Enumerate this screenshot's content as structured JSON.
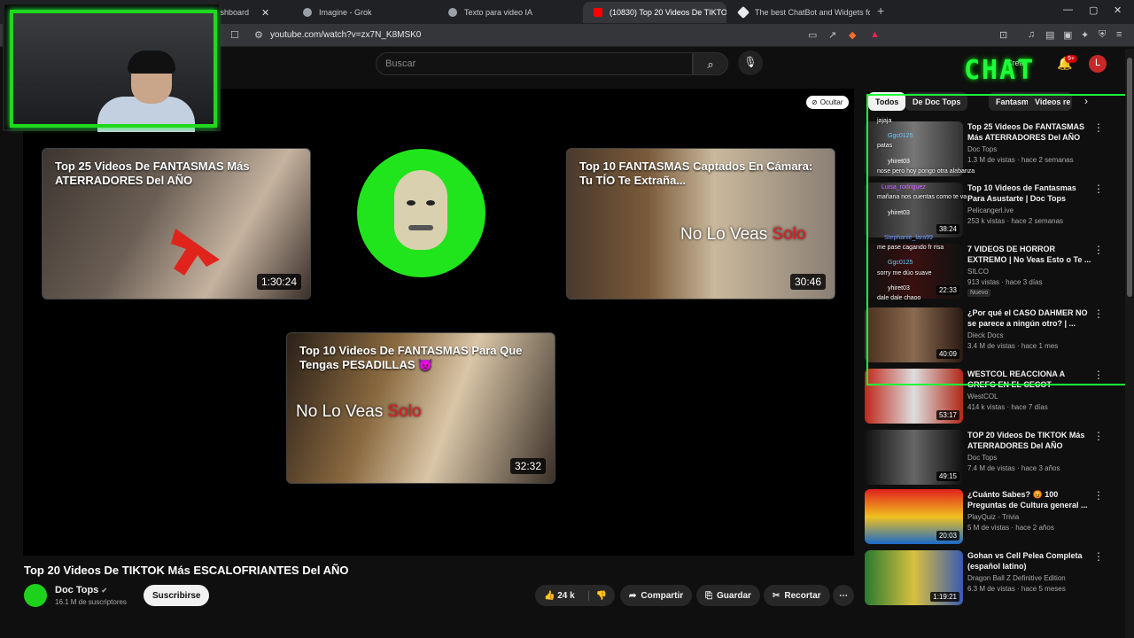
{
  "browser": {
    "tabs": [
      {
        "label": "Dashboard",
        "color": "#5f6368"
      },
      {
        "label": "Imagine - Grok",
        "color": "#9aa0a6"
      },
      {
        "label": "Texto para video IA",
        "color": "#9aa0a6"
      },
      {
        "label": "(10830) Top 20 Videos De TIKTO",
        "color": "#ff0000",
        "active": true
      },
      {
        "label": "The best ChatBot and Widgets for Ki",
        "color": "#e8eaed"
      }
    ],
    "new_tab": "+",
    "window_controls": [
      "—",
      "▢",
      "✕"
    ],
    "url": "youtube.com/watch?v=zx7N_K8MSK0",
    "avatar_letter": "L"
  },
  "youtube": {
    "search_placeholder": "Buscar",
    "create_label": "Crear",
    "notifications_badge": "9+",
    "chat_logo": "CHAT",
    "hide_label": "Ocultar",
    "end_cards": [
      {
        "title": "Top 25 Videos De FANTASMAS Más ATERRADORES Del AÑO",
        "duration": "1:30:24"
      },
      {
        "title": "Top 10 FANTASMAS Captados En Cámara: Tu TÍO Te Extraña...",
        "duration": "30:46",
        "overlay_white": "No Lo Veas",
        "overlay_red": "Solo"
      },
      {
        "title": "Top 10 Videos De FANTASMAS Para Que Tengas PESADILLAS 👿",
        "duration": "32:32",
        "overlay_white": "No Lo Veas",
        "overlay_red": "Solo"
      }
    ],
    "video_title": "Top 20 Videos De TIKTOK Más ESCALOFRIANTES Del AÑO",
    "channel": {
      "name": "Doc Tops",
      "subscribers": "16.1 M de suscriptores",
      "verified": "✔"
    },
    "subscribe_label": "Suscribirse",
    "actions": {
      "likes": "24 k",
      "share": "Compartir",
      "save": "Guardar",
      "clip": "Recortar",
      "more": "⋯"
    },
    "chips": [
      "Todos",
      "De Doc Tops",
      "Fantasma",
      "Videos re"
    ],
    "recommendations": [
      {
        "title": "Top 25 Videos De FANTASMAS Más ATERRADORES Del AÑO",
        "channel": "Doc Tops",
        "meta": "1.3 M de vistas · hace 2 semanas",
        "duration": ""
      },
      {
        "title": "Top 10 Videos de Fantasmas Para Asustarte | Doc Tops",
        "channel": "Pelicangerl.ive",
        "meta": "253 k vistas · hace 2 semanas",
        "duration": "38:24"
      },
      {
        "title": "7 VIDEOS DE HORROR EXTREMO | No Veas Esto o Te ...",
        "channel": "SILCO",
        "meta": "913 vistas · hace 3 días",
        "badge": "Nuevo",
        "duration": "22:33"
      },
      {
        "title": "¿Por qué el CASO DAHMER NO se parece a ningún otro? | ...",
        "channel": "Dieck Docs",
        "meta": "3.4 M de vistas · hace 1 mes",
        "duration": "40:09"
      },
      {
        "title": "WESTCOL REACCIONA A GREFG EN EL CECOT",
        "channel": "WestCOL",
        "meta": "414 k vistas · hace 7 días",
        "duration": "53:17"
      },
      {
        "title": "TOP 20 Videos De TIKTOK Más ATERRADORES Del AÑO",
        "channel": "Doc Tops",
        "meta": "7.4 M de vistas · hace 3 años",
        "duration": "49:15"
      },
      {
        "title": "¿Cuánto Sabes? 😡 100 Preguntas de Cultura general ...",
        "channel": "PlayQuiz - Trivia",
        "meta": "5 M de vistas · hace 2 años",
        "duration": "20:03"
      },
      {
        "title": "Gohan vs Cell Pelea Completa (español latino)",
        "channel": "Dragon Ball Z Definitive Edition",
        "meta": "6.3 M de vistas · hace 5 meses",
        "duration": "1:19:21"
      }
    ]
  },
  "chat_overlay": [
    {
      "user": "",
      "text": "jajaja"
    },
    {
      "user": "Ggc0125",
      "text": ""
    },
    {
      "user": "",
      "text": "patas"
    },
    {
      "user": "yhiret03",
      "text": ""
    },
    {
      "user": "",
      "text": "nose pero hoy pongo otra alabanza"
    },
    {
      "user": "Luisa_rodriguez",
      "text": ""
    },
    {
      "user": "",
      "text": "mañana nos cuentas como te va"
    },
    {
      "user": "yhiret03",
      "text": ""
    },
    {
      "user": "Stephanie_lara99",
      "text": ""
    },
    {
      "user": "",
      "text": "me pase cagando fr risa"
    },
    {
      "user": "Ggc0125",
      "text": ""
    },
    {
      "user": "",
      "text": "sorry me dúo suave"
    },
    {
      "user": "yhiret03",
      "text": ""
    },
    {
      "user": "",
      "text": "dale dale chaoo"
    }
  ],
  "colors": {
    "accent_green": "#1dff3a",
    "yt_red": "#ff0000"
  }
}
